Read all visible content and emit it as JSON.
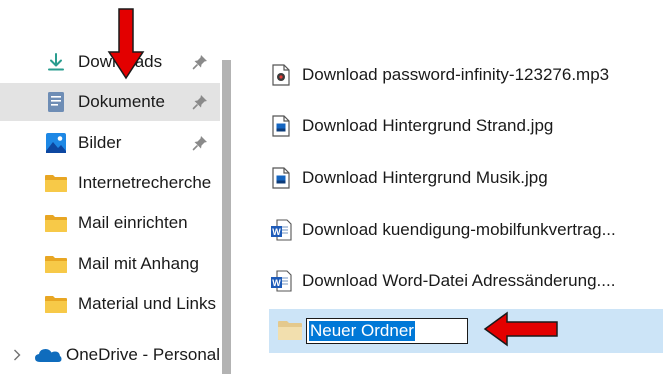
{
  "sidebar": {
    "items": [
      {
        "label": "Downloads",
        "icon": "download-icon",
        "pinned": true
      },
      {
        "label": "Dokumente",
        "icon": "documents-icon",
        "pinned": true,
        "selected": true
      },
      {
        "label": "Bilder",
        "icon": "pictures-icon",
        "pinned": true
      },
      {
        "label": "Internetrecherche",
        "icon": "folder-icon"
      },
      {
        "label": "Mail einrichten",
        "icon": "folder-icon"
      },
      {
        "label": "Mail mit Anhang",
        "icon": "folder-icon"
      },
      {
        "label": "Material und Links",
        "icon": "folder-icon"
      },
      {
        "label": "OneDrive - Personal",
        "icon": "onedrive-icon",
        "expandable": true
      }
    ]
  },
  "files": [
    {
      "name": "Download password-infinity-123276.mp3",
      "icon": "audio-file-icon"
    },
    {
      "name": "Download Hintergrund Strand.jpg",
      "icon": "image-file-icon"
    },
    {
      "name": "Download Hintergrund Musik.jpg",
      "icon": "image-file-icon"
    },
    {
      "name": "Download kuendigung-mobilfunkvertrag...",
      "icon": "word-file-icon"
    },
    {
      "name": "Download Word-Datei Adressänderung....",
      "icon": "word-file-icon"
    }
  ],
  "new_folder": {
    "name": "Neuer Ordner",
    "state": "renaming"
  },
  "colors": {
    "selected_nav": "#e3e3e3",
    "selected_row": "#cce4f7",
    "text_selection": "#0078d7",
    "annotation_arrow": "#e30000",
    "folder": "#f3c144"
  }
}
